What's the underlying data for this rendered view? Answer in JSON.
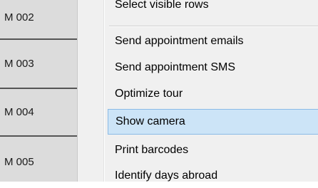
{
  "row_headers": [
    {
      "label": "M 002"
    },
    {
      "label": "M 003"
    },
    {
      "label": "M 004"
    },
    {
      "label": "M 005"
    }
  ],
  "context_menu": {
    "items": [
      {
        "label": "Select visible rows",
        "state": "partially-visible"
      },
      {
        "label": "Send appointment emails"
      },
      {
        "label": "Send appointment SMS"
      },
      {
        "label": "Optimize tour"
      },
      {
        "label": "Show camera",
        "state": "highlighted"
      },
      {
        "label": "Print barcodes"
      },
      {
        "label": "Identify days abroad"
      }
    ],
    "colors": {
      "background": "#f0f0f0",
      "highlight_background": "#cce4f7",
      "highlight_border": "#8bbbe6"
    }
  }
}
